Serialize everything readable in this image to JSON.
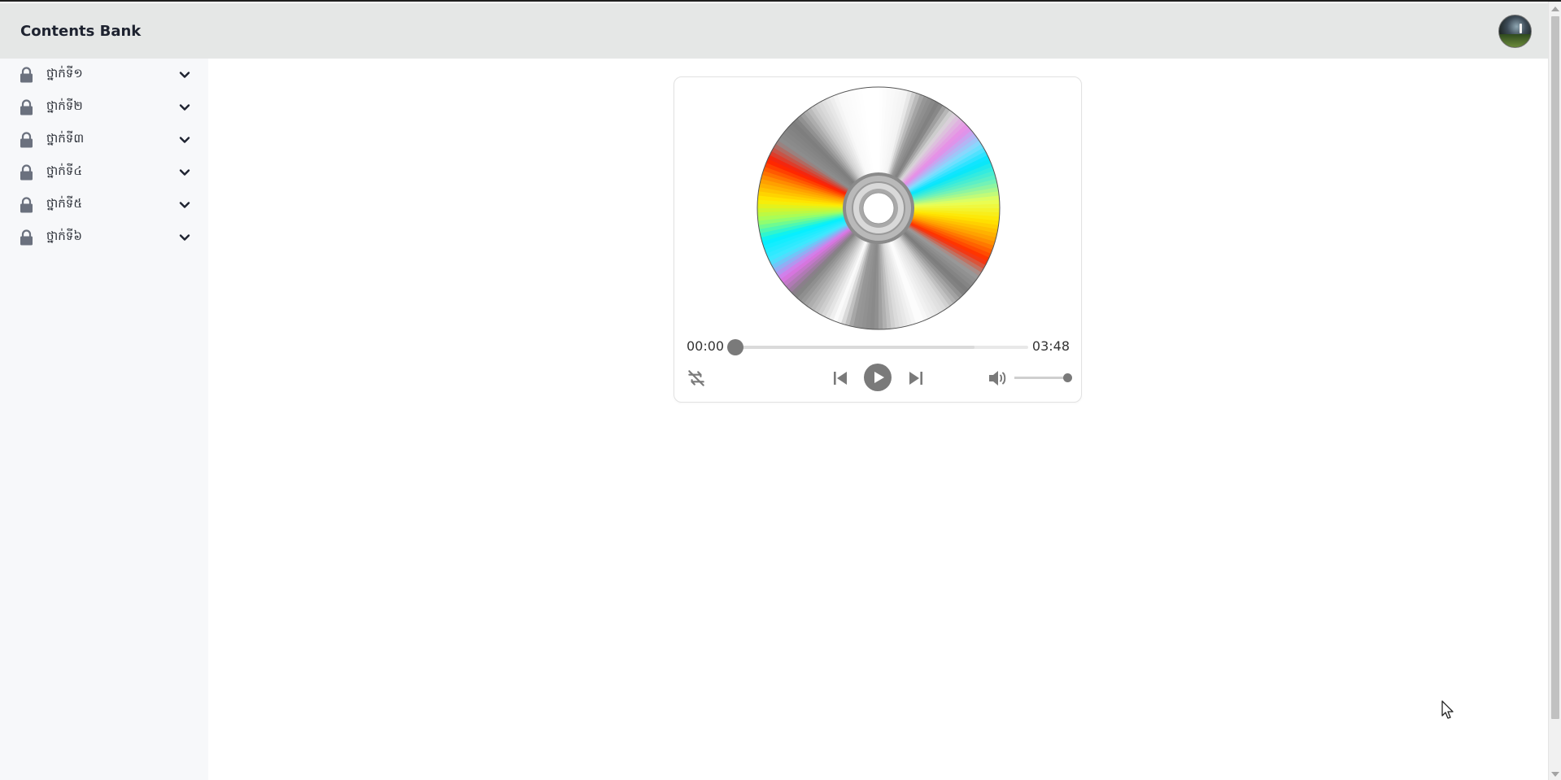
{
  "app": {
    "title": "Contents Bank"
  },
  "header": {
    "brand": "Contents Bank",
    "avatar_icon": "user-avatar"
  },
  "sidebar": {
    "items": [
      {
        "label": "ថ្នាក់ទី១",
        "icon": "lock-icon",
        "expand_icon": "chevron-down-icon"
      },
      {
        "label": "ថ្នាក់ទី២",
        "icon": "lock-icon",
        "expand_icon": "chevron-down-icon"
      },
      {
        "label": "ថ្នាក់ទី៣",
        "icon": "lock-icon",
        "expand_icon": "chevron-down-icon"
      },
      {
        "label": "ថ្នាក់ទី៤",
        "icon": "lock-icon",
        "expand_icon": "chevron-down-icon"
      },
      {
        "label": "ថ្នាក់ទី៥",
        "icon": "lock-icon",
        "expand_icon": "chevron-down-icon"
      },
      {
        "label": "ថ្នាក់ទី៦",
        "icon": "lock-icon",
        "expand_icon": "chevron-down-icon"
      }
    ]
  },
  "player": {
    "artwork_icon": "cd-disc-icon",
    "current_time": "00:00",
    "duration": "03:48",
    "progress": 0.0,
    "buffered": 0.82,
    "volume": 1.0,
    "controls": {
      "repeat_icon": "repeat-icon",
      "previous_icon": "skip-previous-icon",
      "play_icon": "play-icon",
      "next_icon": "skip-next-icon",
      "volume_icon": "volume-icon"
    }
  },
  "colors": {
    "header_bg": "#e5e7e6",
    "sidebar_bg": "#f7f8fa",
    "control_gray": "#7a7a7a"
  }
}
